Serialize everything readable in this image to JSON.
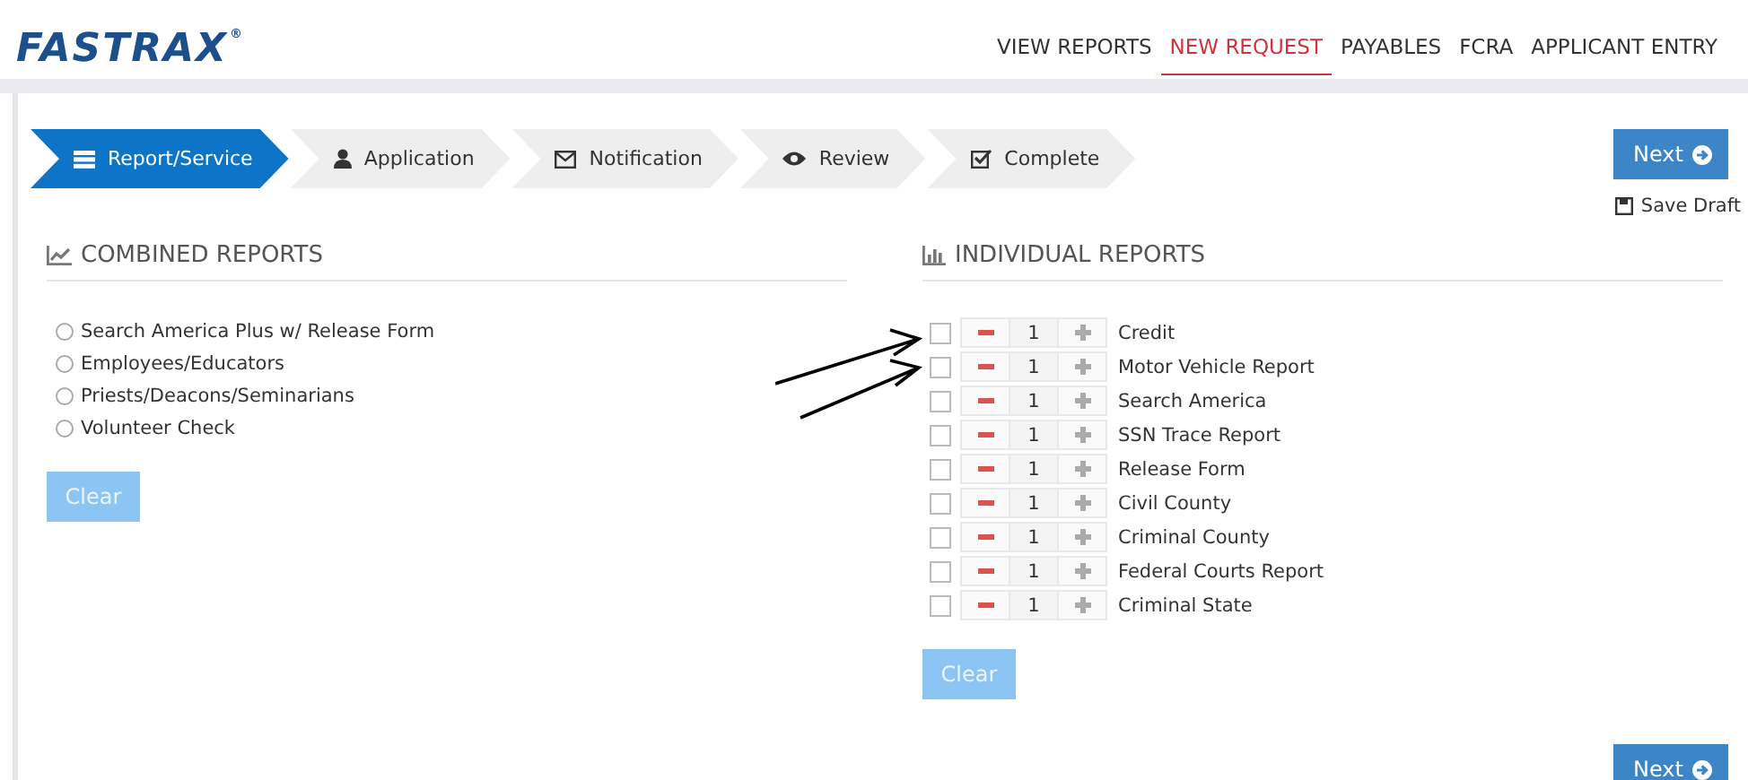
{
  "header": {
    "logo": "FASTRAX",
    "logo_mark": "®",
    "nav": [
      {
        "label": "VIEW REPORTS",
        "selected": false
      },
      {
        "label": "NEW REQUEST",
        "selected": true
      },
      {
        "label": "PAYABLES",
        "selected": false
      },
      {
        "label": "FCRA",
        "selected": false
      },
      {
        "label": "APPLICANT ENTRY",
        "selected": false
      }
    ]
  },
  "steps": [
    {
      "label": "Report/Service",
      "selected": true
    },
    {
      "label": "Application",
      "selected": false
    },
    {
      "label": "Notification",
      "selected": false
    },
    {
      "label": "Review",
      "selected": false
    },
    {
      "label": "Complete",
      "selected": false
    }
  ],
  "next_button": "Next",
  "save_draft": "Save Draft",
  "combined_reports": {
    "title": "COMBINED REPORTS",
    "options": [
      {
        "label": "Search America Plus w/ Release Form",
        "selected": false
      },
      {
        "label": "Employees/Educators",
        "selected": false
      },
      {
        "label": "Priests/Deacons/Seminarians",
        "selected": false
      },
      {
        "label": "Volunteer Check",
        "selected": false
      }
    ],
    "clear_button": "Clear"
  },
  "individual_reports": {
    "title": "INDIVIDUAL REPORTS",
    "items": [
      {
        "label": "Credit",
        "checked": false,
        "quantity": "1"
      },
      {
        "label": "Motor Vehicle Report",
        "checked": false,
        "quantity": "1"
      },
      {
        "label": "Search America",
        "checked": false,
        "quantity": "1"
      },
      {
        "label": "SSN Trace Report",
        "checked": false,
        "quantity": "1"
      },
      {
        "label": "Release Form",
        "checked": false,
        "quantity": "1"
      },
      {
        "label": "Civil County",
        "checked": false,
        "quantity": "1"
      },
      {
        "label": "Criminal County",
        "checked": false,
        "quantity": "1"
      },
      {
        "label": "Federal Courts Report",
        "checked": false,
        "quantity": "1"
      },
      {
        "label": "Criminal State",
        "checked": false,
        "quantity": "1"
      }
    ],
    "clear_button": "Clear"
  },
  "bottom_next_button": "Next"
}
